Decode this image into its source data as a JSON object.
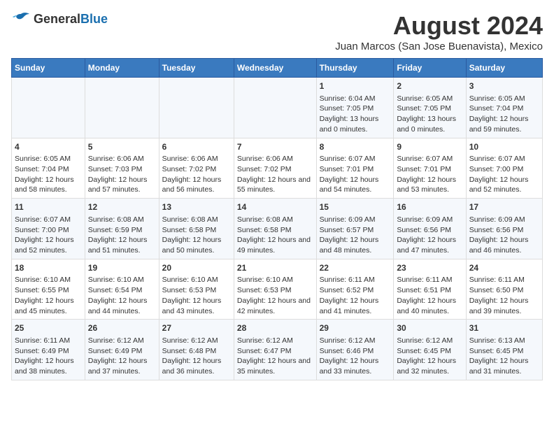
{
  "logo": {
    "general": "General",
    "blue": "Blue"
  },
  "title": "August 2024",
  "subtitle": "Juan Marcos (San Jose Buenavista), Mexico",
  "days_of_week": [
    "Sunday",
    "Monday",
    "Tuesday",
    "Wednesday",
    "Thursday",
    "Friday",
    "Saturday"
  ],
  "weeks": [
    [
      {
        "day": "",
        "content": ""
      },
      {
        "day": "",
        "content": ""
      },
      {
        "day": "",
        "content": ""
      },
      {
        "day": "",
        "content": ""
      },
      {
        "day": "1",
        "content": "Sunrise: 6:04 AM\nSunset: 7:05 PM\nDaylight: 13 hours and 0 minutes."
      },
      {
        "day": "2",
        "content": "Sunrise: 6:05 AM\nSunset: 7:05 PM\nDaylight: 13 hours and 0 minutes."
      },
      {
        "day": "3",
        "content": "Sunrise: 6:05 AM\nSunset: 7:04 PM\nDaylight: 12 hours and 59 minutes."
      }
    ],
    [
      {
        "day": "4",
        "content": "Sunrise: 6:05 AM\nSunset: 7:04 PM\nDaylight: 12 hours and 58 minutes."
      },
      {
        "day": "5",
        "content": "Sunrise: 6:06 AM\nSunset: 7:03 PM\nDaylight: 12 hours and 57 minutes."
      },
      {
        "day": "6",
        "content": "Sunrise: 6:06 AM\nSunset: 7:02 PM\nDaylight: 12 hours and 56 minutes."
      },
      {
        "day": "7",
        "content": "Sunrise: 6:06 AM\nSunset: 7:02 PM\nDaylight: 12 hours and 55 minutes."
      },
      {
        "day": "8",
        "content": "Sunrise: 6:07 AM\nSunset: 7:01 PM\nDaylight: 12 hours and 54 minutes."
      },
      {
        "day": "9",
        "content": "Sunrise: 6:07 AM\nSunset: 7:01 PM\nDaylight: 12 hours and 53 minutes."
      },
      {
        "day": "10",
        "content": "Sunrise: 6:07 AM\nSunset: 7:00 PM\nDaylight: 12 hours and 52 minutes."
      }
    ],
    [
      {
        "day": "11",
        "content": "Sunrise: 6:07 AM\nSunset: 7:00 PM\nDaylight: 12 hours and 52 minutes."
      },
      {
        "day": "12",
        "content": "Sunrise: 6:08 AM\nSunset: 6:59 PM\nDaylight: 12 hours and 51 minutes."
      },
      {
        "day": "13",
        "content": "Sunrise: 6:08 AM\nSunset: 6:58 PM\nDaylight: 12 hours and 50 minutes."
      },
      {
        "day": "14",
        "content": "Sunrise: 6:08 AM\nSunset: 6:58 PM\nDaylight: 12 hours and 49 minutes."
      },
      {
        "day": "15",
        "content": "Sunrise: 6:09 AM\nSunset: 6:57 PM\nDaylight: 12 hours and 48 minutes."
      },
      {
        "day": "16",
        "content": "Sunrise: 6:09 AM\nSunset: 6:56 PM\nDaylight: 12 hours and 47 minutes."
      },
      {
        "day": "17",
        "content": "Sunrise: 6:09 AM\nSunset: 6:56 PM\nDaylight: 12 hours and 46 minutes."
      }
    ],
    [
      {
        "day": "18",
        "content": "Sunrise: 6:10 AM\nSunset: 6:55 PM\nDaylight: 12 hours and 45 minutes."
      },
      {
        "day": "19",
        "content": "Sunrise: 6:10 AM\nSunset: 6:54 PM\nDaylight: 12 hours and 44 minutes."
      },
      {
        "day": "20",
        "content": "Sunrise: 6:10 AM\nSunset: 6:53 PM\nDaylight: 12 hours and 43 minutes."
      },
      {
        "day": "21",
        "content": "Sunrise: 6:10 AM\nSunset: 6:53 PM\nDaylight: 12 hours and 42 minutes."
      },
      {
        "day": "22",
        "content": "Sunrise: 6:11 AM\nSunset: 6:52 PM\nDaylight: 12 hours and 41 minutes."
      },
      {
        "day": "23",
        "content": "Sunrise: 6:11 AM\nSunset: 6:51 PM\nDaylight: 12 hours and 40 minutes."
      },
      {
        "day": "24",
        "content": "Sunrise: 6:11 AM\nSunset: 6:50 PM\nDaylight: 12 hours and 39 minutes."
      }
    ],
    [
      {
        "day": "25",
        "content": "Sunrise: 6:11 AM\nSunset: 6:49 PM\nDaylight: 12 hours and 38 minutes."
      },
      {
        "day": "26",
        "content": "Sunrise: 6:12 AM\nSunset: 6:49 PM\nDaylight: 12 hours and 37 minutes."
      },
      {
        "day": "27",
        "content": "Sunrise: 6:12 AM\nSunset: 6:48 PM\nDaylight: 12 hours and 36 minutes."
      },
      {
        "day": "28",
        "content": "Sunrise: 6:12 AM\nSunset: 6:47 PM\nDaylight: 12 hours and 35 minutes."
      },
      {
        "day": "29",
        "content": "Sunrise: 6:12 AM\nSunset: 6:46 PM\nDaylight: 12 hours and 33 minutes."
      },
      {
        "day": "30",
        "content": "Sunrise: 6:12 AM\nSunset: 6:45 PM\nDaylight: 12 hours and 32 minutes."
      },
      {
        "day": "31",
        "content": "Sunrise: 6:13 AM\nSunset: 6:45 PM\nDaylight: 12 hours and 31 minutes."
      }
    ]
  ]
}
